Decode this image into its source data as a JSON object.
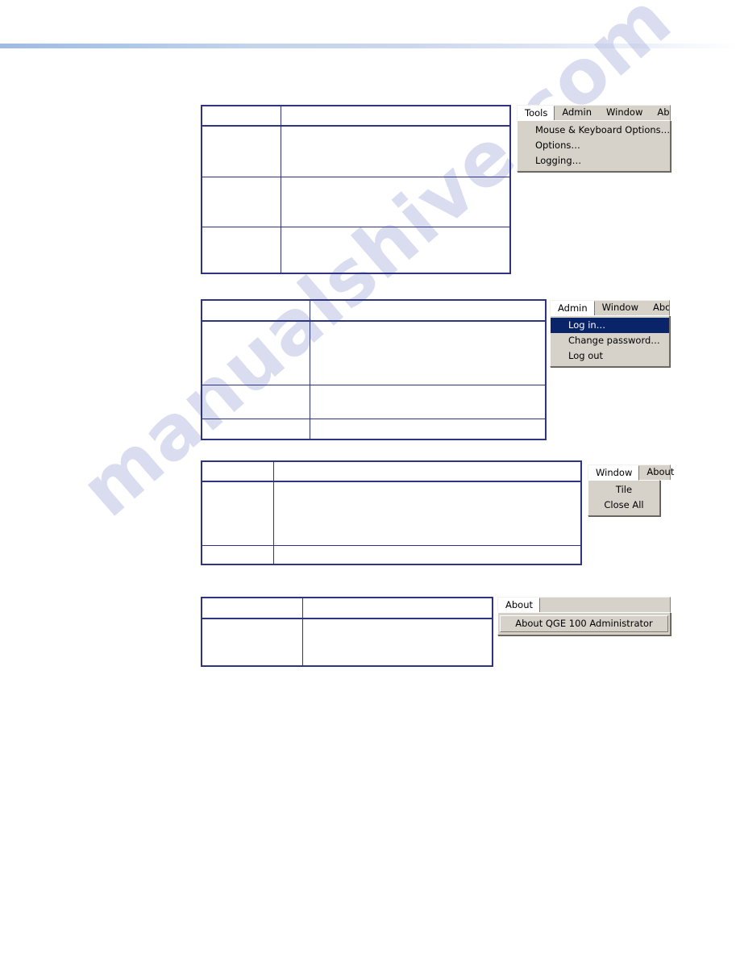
{
  "page": {
    "watermark_text": "manualshive.com",
    "rule_color_start": "#9fbbe0",
    "rule_color_end": "#ffffff",
    "table_border_color": "#2e3480"
  },
  "tables": [
    {
      "name": "tools-menu-table",
      "columns": [
        "",
        ""
      ],
      "rows": [
        [
          "",
          ""
        ],
        [
          "",
          ""
        ],
        [
          "",
          ""
        ]
      ]
    },
    {
      "name": "admin-menu-table",
      "columns": [
        "",
        ""
      ],
      "rows": [
        [
          "",
          ""
        ],
        [
          "",
          ""
        ],
        [
          "",
          ""
        ]
      ]
    },
    {
      "name": "window-menu-table",
      "columns": [
        "",
        ""
      ],
      "rows": [
        [
          "",
          ""
        ],
        [
          "",
          ""
        ]
      ]
    },
    {
      "name": "about-menu-table",
      "columns": [
        "",
        ""
      ],
      "rows": [
        [
          "",
          ""
        ]
      ]
    }
  ],
  "menus": {
    "tools": {
      "bar": [
        {
          "label": "Tools",
          "open": true
        },
        {
          "label": "Admin",
          "open": false
        },
        {
          "label": "Window",
          "open": false
        },
        {
          "label": "About",
          "open": false
        }
      ],
      "items": [
        {
          "label": "Mouse & Keyboard Options…",
          "selected": false
        },
        {
          "label": "Options…",
          "selected": false
        },
        {
          "label": "Logging…",
          "selected": false
        }
      ]
    },
    "admin": {
      "bar": [
        {
          "label": "Admin",
          "open": true
        },
        {
          "label": "Window",
          "open": false
        },
        {
          "label": "About",
          "open": false
        }
      ],
      "items": [
        {
          "label": "Log in…",
          "selected": true
        },
        {
          "label": "Change password…",
          "selected": false
        },
        {
          "label": "Log out",
          "selected": false
        }
      ]
    },
    "window": {
      "bar": [
        {
          "label": "Window",
          "open": true
        },
        {
          "label": "About",
          "open": false
        }
      ],
      "items": [
        {
          "label": "Tile",
          "selected": false
        },
        {
          "label": "Close All",
          "selected": false
        }
      ]
    },
    "about": {
      "bar": [
        {
          "label": "About",
          "open": true
        }
      ],
      "items": [
        {
          "label": "About QGE 100 Administrator",
          "selected": false
        }
      ]
    },
    "highlight_color": "#0a246a",
    "face_color": "#d6d2ca"
  }
}
